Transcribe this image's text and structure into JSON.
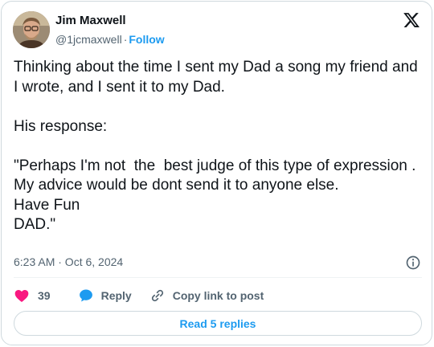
{
  "author": {
    "name": "Jim Maxwell",
    "handle": "@1jcmaxwell",
    "separator": "·",
    "follow_label": "Follow"
  },
  "tweet": {
    "text": "Thinking about the time I sent my Dad a song my friend and I wrote, and I sent it to my Dad.\n\nHis response:\n\n\"Perhaps I'm not  the  best judge of this type of expression . My advice would be dont send it to anyone else.\nHave Fun\nDAD.\"",
    "timestamp": "6:23 AM · Oct 6, 2024"
  },
  "actions": {
    "like_count": "39",
    "reply_label": "Reply",
    "copy_label": "Copy link to post"
  },
  "footer": {
    "read_replies_label": "Read 5 replies"
  },
  "icons": {
    "logo": "x-logo-icon",
    "info": "info-icon",
    "like": "heart-icon",
    "reply": "speech-bubble-icon",
    "copy": "link-icon"
  },
  "colors": {
    "accent": "#1d9bf0",
    "like": "#f91880",
    "text": "#0f1419",
    "muted": "#536471",
    "border": "#cfd9de"
  }
}
